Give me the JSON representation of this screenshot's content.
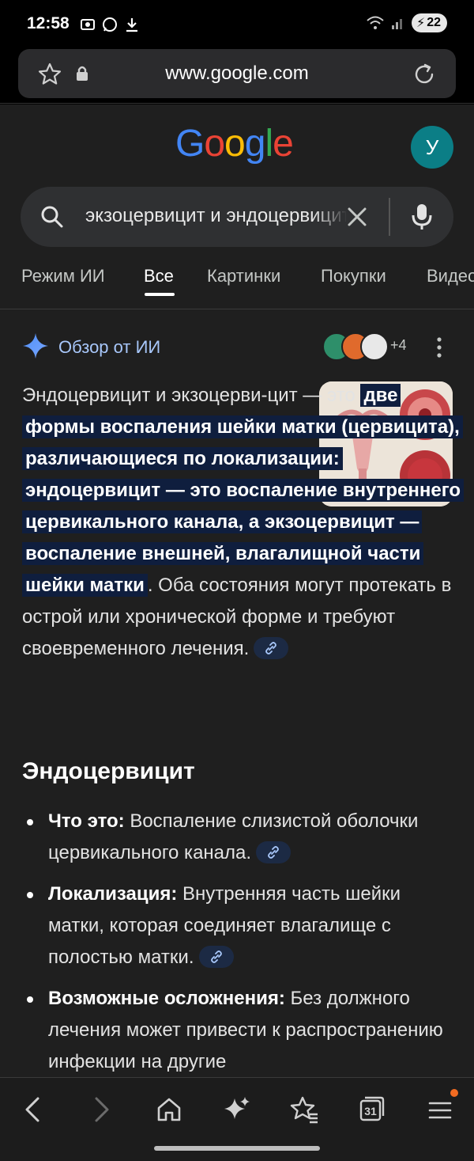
{
  "status_bar": {
    "time": "12:58",
    "battery": "22"
  },
  "browser": {
    "url": "www.google.com"
  },
  "header": {
    "logo": "Google",
    "avatar_letter": "У"
  },
  "search": {
    "query": "экзоцервицит и эндоцервицит"
  },
  "tabs": [
    "Режим ИИ",
    "Все",
    "Картинки",
    "Покупки",
    "Видео"
  ],
  "ai_overview": {
    "title": "Обзор от ИИ",
    "sources_more": "+4",
    "paragraph": {
      "p1": "Эндоцервицит и экзоцерви-цит — это ",
      "highlight": "две формы воспаления шейки матки (цервицита), различающиеся по локализации: эндоцервицит — это воспаление внутреннего цервикального канала, а экзоцервицит — воспаление внешней, влагалищной части шейки матки",
      "p2": ". Оба состояния могут протекать в острой или хронической форме и требуют своевременного лечения."
    },
    "section_heading": "Эндоцервицит",
    "items": [
      {
        "label": "Что это:",
        "text": " Воспаление слизистой оболочки цервикального канала."
      },
      {
        "label": "Локализация:",
        "text": " Внутренняя часть шейки матки, которая соединяет влагалище с полостью матки."
      },
      {
        "label": "Возможные осложнения:",
        "text": " Без должного лечения может привести к распространению инфекции на другие"
      }
    ]
  },
  "bottom_nav": {
    "tabs_count": "31",
    "icons": [
      "back-icon",
      "forward-icon",
      "home-icon",
      "ai-sparkle-icon",
      "bookmark-star-icon",
      "tabs-icon",
      "menu-icon"
    ]
  },
  "colors": {
    "background": "#1f1f1f",
    "ai_title": "#a8c7fa",
    "highlight": "#0f1e3e",
    "avatar": "#0b7e86",
    "notification_dot": "#f26b21"
  }
}
